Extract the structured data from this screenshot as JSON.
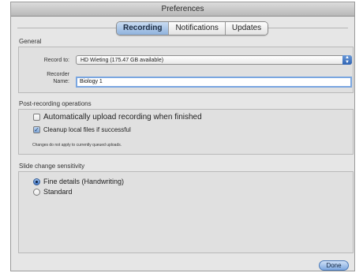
{
  "window": {
    "title": "Preferences"
  },
  "tabs": [
    {
      "label": "Recording",
      "selected": true
    },
    {
      "label": "Notifications",
      "selected": false
    },
    {
      "label": "Updates",
      "selected": false
    }
  ],
  "general": {
    "title": "General",
    "record_to_label": "Record to:",
    "record_to_value": "HD Wieting (175.47 GB available)",
    "recorder_name_label_line1": "Recorder",
    "recorder_name_label_line2": "Name:",
    "recorder_name_value": "Biology 1"
  },
  "post_recording": {
    "title": "Post-recording operations",
    "auto_upload_label": "Automatically upload recording when finished",
    "auto_upload_checked": false,
    "cleanup_label": "Cleanup local files if successful",
    "cleanup_checked": true,
    "note": "Changes do not apply to currently queued uploads."
  },
  "slide_change": {
    "title": "Slide change sensitivity",
    "options": [
      {
        "label": "Fine details (Handwriting)",
        "selected": true
      },
      {
        "label": "Standard",
        "selected": false
      }
    ]
  },
  "footer": {
    "done_label": "Done"
  },
  "colors": {
    "accent": "#3e74c6"
  }
}
